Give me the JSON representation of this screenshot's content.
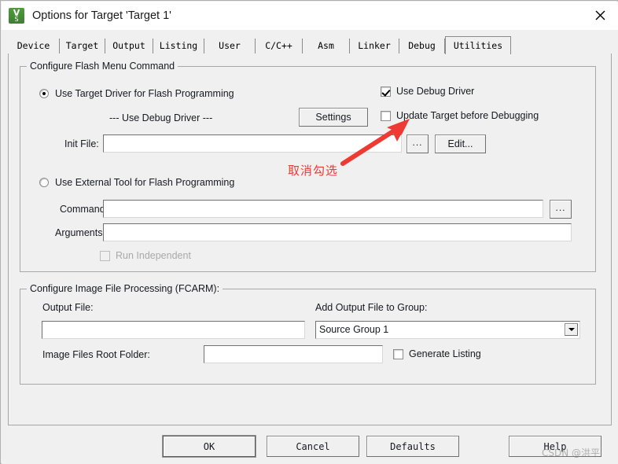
{
  "window": {
    "title": "Options for Target 'Target 1'",
    "app_icon": "uvision-icon",
    "close_label": "✕"
  },
  "tabs": [
    {
      "label": "Device",
      "active": false
    },
    {
      "label": "Target",
      "active": false
    },
    {
      "label": "Output",
      "active": false
    },
    {
      "label": "Listing",
      "active": false
    },
    {
      "label": "User",
      "active": false
    },
    {
      "label": "C/C++",
      "active": false
    },
    {
      "label": "Asm",
      "active": false
    },
    {
      "label": "Linker",
      "active": false
    },
    {
      "label": "Debug",
      "active": false
    },
    {
      "label": "Utilities",
      "active": true
    }
  ],
  "flash_group": {
    "title": "Configure Flash Menu Command",
    "use_target_driver": {
      "label": "Use Target Driver for Flash Programming",
      "checked": true
    },
    "driver_name": "--- Use Debug Driver ---",
    "settings_button": "Settings",
    "use_debug_driver": {
      "label": "Use Debug Driver",
      "checked": true
    },
    "update_target": {
      "label": "Update Target before Debugging",
      "checked": false
    },
    "init_file": {
      "label": "Init File:",
      "value": "",
      "placeholder": ""
    },
    "browse_button": "...",
    "edit_button": "Edit...",
    "use_external_tool": {
      "label": "Use External Tool for Flash Programming",
      "checked": false
    },
    "command": {
      "label": "Command:",
      "value": "",
      "placeholder": ""
    },
    "arguments": {
      "label": "Arguments:",
      "value": "",
      "placeholder": ""
    },
    "command_browse_button": "...",
    "run_independent": {
      "label": "Run Independent",
      "checked": false,
      "disabled": true
    }
  },
  "fcarm_group": {
    "title": "Configure Image File Processing (FCARM):",
    "output_file": {
      "label": "Output File:",
      "value": "",
      "placeholder": ""
    },
    "add_output_to_group": {
      "label": "Add Output File  to Group:",
      "value": "Source Group 1",
      "options": [
        "Source Group 1"
      ]
    },
    "image_files_root_folder": {
      "label": "Image Files Root Folder:",
      "value": "",
      "placeholder": ""
    },
    "generate_listing": {
      "label": "Generate Listing",
      "checked": false
    }
  },
  "buttons": {
    "ok": "OK",
    "cancel": "Cancel",
    "defaults": "Defaults",
    "help": "Help"
  },
  "annotations": {
    "uncheck_note": "取消勾选",
    "arrow_color": "#ee3a33",
    "watermark": "CSDN @洪平"
  },
  "colors": {
    "dialog_bg": "#f0f0f0",
    "titlebar_bg": "#ffffff",
    "text": "#16191f",
    "border": "#a8a8a8",
    "accent_red": "#ee3a33",
    "icon_green": "#4f9b3c"
  }
}
